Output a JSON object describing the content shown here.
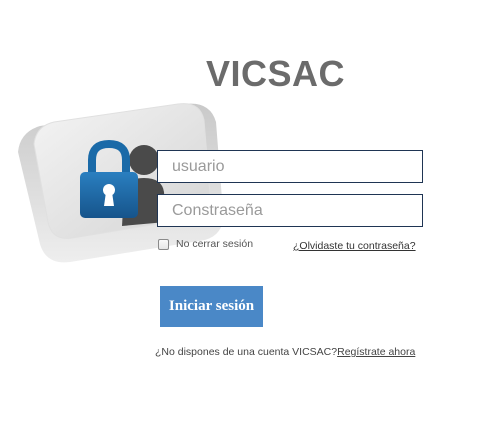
{
  "brand": {
    "title": "VICSAC"
  },
  "login": {
    "username_placeholder": "usuario",
    "password_placeholder": "Constraseña",
    "remember_label": "No cerrar sesión",
    "forgot_link": "¿Olvidaste tu contraseña?",
    "submit_label": "Iniciar sesión",
    "signup_prompt": "¿No dispones de una cuenta VICSAC?",
    "signup_link": "Regístrate ahora"
  },
  "graphic": {
    "icon": "keyboard-key-lock-user-icon",
    "accent": "#1a6aa8"
  }
}
